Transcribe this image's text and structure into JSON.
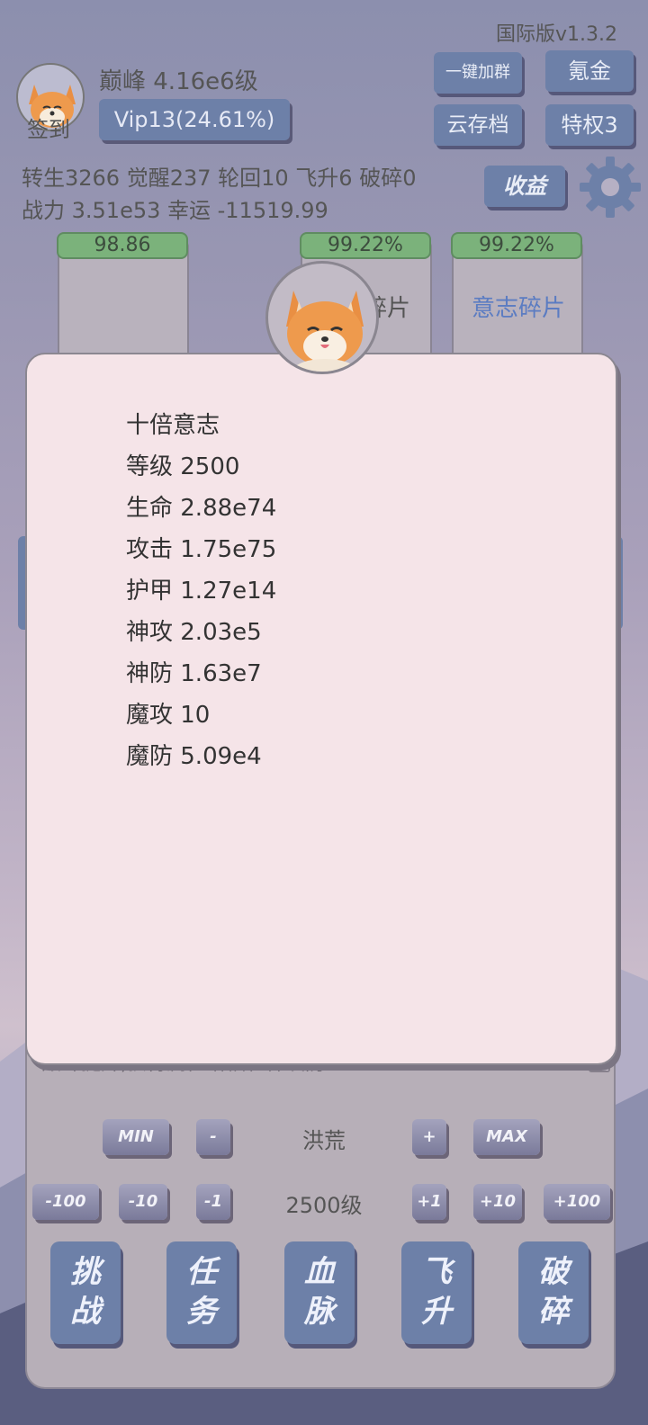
{
  "header": {
    "version": "国际版v1.3.2",
    "signin_label": "签到",
    "rank_text": "巅峰 4.16e6级",
    "vip_label": "Vip13(24.61%)",
    "stats_line1": "转生3266 觉醒237 轮回10 飞升6 破碎0",
    "stats_line2": "战力 3.51e53  幸运 -11519.99",
    "buttons": {
      "join_group": "一键加群",
      "krypton": "氪金",
      "cloud_save": "云存档",
      "privilege": "特权3",
      "income": "收益"
    }
  },
  "cards": [
    {
      "percent": "98.86",
      "label": ""
    },
    {
      "percent": "99.22%",
      "label": "意志碎片"
    },
    {
      "percent": "99.22%",
      "label": "意志碎片"
    }
  ],
  "modal": {
    "title": "十倍意志",
    "lines": [
      "等级 2500",
      "生命 2.88e74",
      "攻击 1.75e75",
      "护甲 1.27e14",
      "神攻 2.03e5",
      "神防 1.63e7",
      "魔攻 10",
      "魔防 5.09e4"
    ]
  },
  "panel": {
    "hint_text": "巅峰提升,获得属性增幅和神攻防",
    "area_name": "洪荒",
    "level_text": "2500级",
    "btn_min": "MIN",
    "btn_minus": "-",
    "btn_plus": "+",
    "btn_max": "MAX",
    "btn_m100": "-100",
    "btn_m10": "-10",
    "btn_m1": "-1",
    "btn_p1": "+1",
    "btn_p10": "+10",
    "btn_p100": "+100"
  },
  "nav": [
    {
      "top": "挑",
      "bottom": "战"
    },
    {
      "top": "任",
      "bottom": "务"
    },
    {
      "top": "血",
      "bottom": "脉"
    },
    {
      "top": "飞",
      "bottom": "升"
    },
    {
      "top": "破",
      "bottom": "碎"
    }
  ],
  "colors": {
    "accent": "#6d80a8",
    "progress": "#7bb27b",
    "modal_bg": "#f5e4e8"
  },
  "icons": [
    "corgi-avatar-icon",
    "gear-icon"
  ]
}
